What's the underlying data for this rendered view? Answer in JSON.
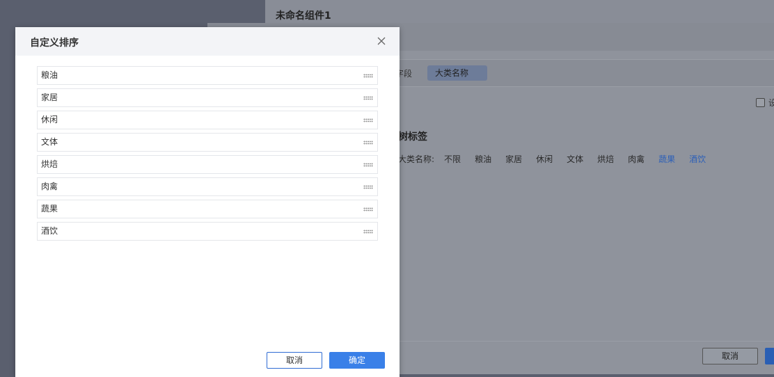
{
  "background": {
    "component_title": "未命名组件1",
    "field_label": "字段",
    "field_chip": "大类名称",
    "checkbox_text": "设",
    "tag_title": "树标签",
    "filter_label": "大类名称:",
    "filter_items": [
      "不限",
      "粮油",
      "家居",
      "休闲",
      "文体",
      "烘焙",
      "肉禽",
      "蔬果",
      "酒饮"
    ],
    "filter_selected": [
      "蔬果",
      "酒饮"
    ],
    "cancel_label": "取消"
  },
  "dialog": {
    "title": "自定义排序",
    "close_icon": "close-icon",
    "items": [
      "粮油",
      "家居",
      "休闲",
      "文体",
      "烘焙",
      "肉禽",
      "蔬果",
      "酒饮"
    ],
    "cancel_label": "取消",
    "ok_label": "确定"
  },
  "colors": {
    "accent": "#3a80e8",
    "selected_text": "#2b5fb8"
  }
}
